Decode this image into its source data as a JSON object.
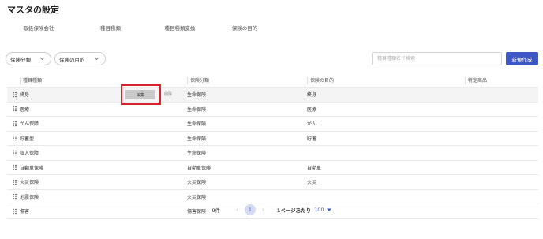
{
  "page_title": "マスタの設定",
  "tabs": [
    {
      "label": "取扱保険会社",
      "active": false
    },
    {
      "label": "種目種類",
      "active": true
    },
    {
      "label": "種目種類変換",
      "active": false
    },
    {
      "label": "保険の目的",
      "active": false
    }
  ],
  "filters": [
    {
      "label": "保険分類",
      "icon": "chevron-down-icon"
    },
    {
      "label": "保険の目的",
      "icon": "chevron-down-icon"
    }
  ],
  "search": {
    "placeholder": "種目種類名で検索",
    "value": ""
  },
  "new_button_label": "新規作成",
  "table": {
    "headers": [
      "種目種類",
      "保険分類",
      "保険の目的",
      "特定商品"
    ],
    "rows": [
      {
        "name": "終身",
        "category": "生命保険",
        "purpose": "終身",
        "special": "",
        "highlighted": true
      },
      {
        "name": "医療",
        "category": "生命保険",
        "purpose": "医療",
        "special": ""
      },
      {
        "name": "がん保障",
        "category": "生命保険",
        "purpose": "がん",
        "special": ""
      },
      {
        "name": "貯蓄型",
        "category": "生命保険",
        "purpose": "貯蓄",
        "special": ""
      },
      {
        "name": "収入保障",
        "category": "生命保険",
        "purpose": "",
        "special": ""
      },
      {
        "name": "自動車保険",
        "category": "自動車保険",
        "purpose": "自動車",
        "special": ""
      },
      {
        "name": "火災保険",
        "category": "火災保険",
        "purpose": "火災",
        "special": ""
      },
      {
        "name": "地震保険",
        "category": "火災保険",
        "purpose": "",
        "special": ""
      },
      {
        "name": "傷害",
        "category": "傷害保険",
        "purpose": "",
        "special": ""
      }
    ],
    "row_actions": {
      "edit_label": "編集",
      "delete_label": "削除"
    }
  },
  "pagination": {
    "total": "9件",
    "prev": "‹",
    "current_page": "1",
    "next": "›",
    "per_page_label": "1ページあたり",
    "per_page_value": "100"
  },
  "colors": {
    "accent": "#3d57c4",
    "tab_active_bg": "#d6dbf2",
    "highlight_frame": "#d9232a"
  }
}
